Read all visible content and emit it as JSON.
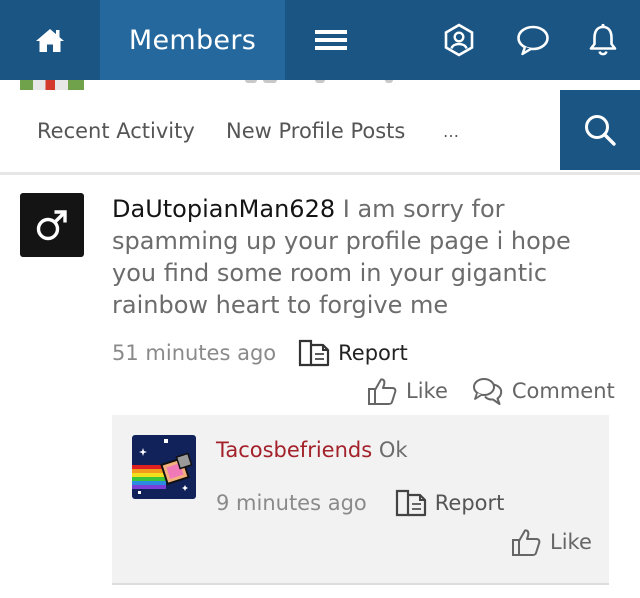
{
  "header": {
    "title": "Members",
    "icons": [
      "home-icon",
      "menu-icon",
      "user-badge-icon",
      "chat-bubble-icon",
      "bell-icon"
    ],
    "colors": {
      "bar": "#1b5584",
      "active_tab": "#24689e"
    }
  },
  "tabs": {
    "items": [
      {
        "label": "Recent Activity"
      },
      {
        "label": "New Profile Posts"
      },
      {
        "label": "…"
      }
    ],
    "search_icon": "search-icon"
  },
  "post": {
    "author": "DaUtopianMan628",
    "message": "I am sorry for spamming up your profile page i hope you find some room in your gigantic rainbow heart to forgive me",
    "time": "51 minutes ago",
    "report_label": "Report",
    "like_label": "Like",
    "comment_label": "Comment",
    "avatar_icon": "male-symbol-icon"
  },
  "comment": {
    "author": "Tacosbefriends",
    "message": "Ok",
    "time": "9 minutes ago",
    "report_label": "Report",
    "like_label": "Like",
    "author_color": "#a3212a"
  }
}
